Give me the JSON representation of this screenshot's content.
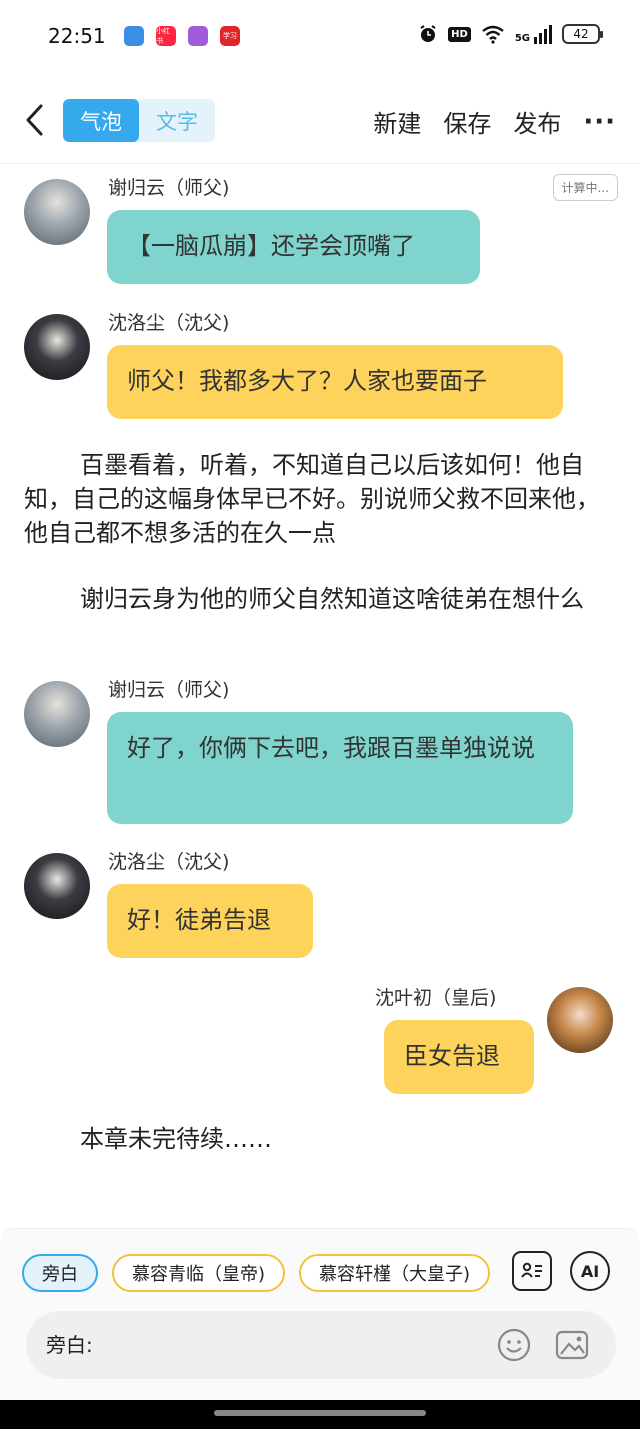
{
  "status": {
    "time": "22:51",
    "apps": [
      {
        "icon": "app-blue-icon",
        "label": "",
        "color": "#3a8ee6"
      },
      {
        "icon": "xiaohongshu-icon",
        "label": "小红书",
        "color": "#ff2442"
      },
      {
        "icon": "app-purple-icon",
        "label": "",
        "color": "#a05cd8"
      },
      {
        "icon": "app-red-icon",
        "label": "学习",
        "color": "#e0262a"
      }
    ],
    "hd": "HD",
    "network": "5G",
    "battery": "42"
  },
  "nav": {
    "mode_bubble": "气泡",
    "mode_text": "文字",
    "new_label": "新建",
    "save_label": "保存",
    "publish_label": "发布",
    "more": "···"
  },
  "chat": {
    "calc_tag": "计算中...",
    "messages": [
      {
        "name": "谢归云（师父)",
        "text": "【一脑瓜崩】还学会顶嘴了"
      },
      {
        "name": "沈洛尘（沈父)",
        "text": "师父！我都多大了？人家也要面子"
      },
      {
        "text": "百墨看着，听着，不知道自己以后该如何！他自知，自己的这幅身体早已不好。别说师父救不回来他，他自己都不想多活的在久一点"
      },
      {
        "text": "谢归云身为他的师父自然知道这啥徒弟在想什么"
      },
      {
        "name": "谢归云（师父)",
        "text": "好了，你俩下去吧，我跟百墨单独说说"
      },
      {
        "name": "沈洛尘（沈父)",
        "text": "好！徒弟告退"
      },
      {
        "name": "沈叶初（皇后)",
        "text": "臣女告退"
      },
      {
        "text": "本章未完待续……"
      }
    ]
  },
  "composer": {
    "chips": [
      "旁白",
      "慕容青临（皇帝)",
      "慕容轩槿（大皇子)"
    ],
    "ai_label": "AI",
    "input_placeholder": "旁白:"
  },
  "colors": {
    "accent": "#36a9ec",
    "teal_bubble": "#7fd4cd",
    "yellow_bubble": "#fdd35b",
    "chip_border": "#f3c23c"
  }
}
